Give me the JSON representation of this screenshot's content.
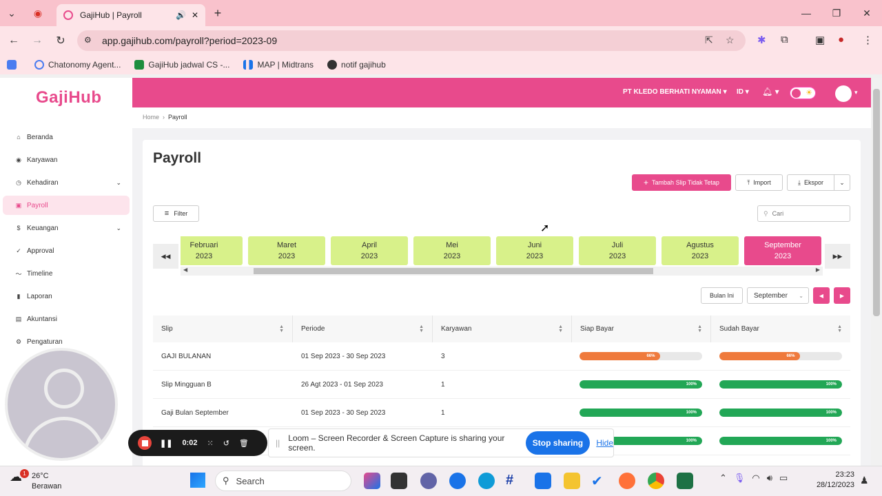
{
  "browser": {
    "tab_title": "GajiHub | Payroll",
    "url": "app.gajihub.com/payroll?period=2023-09",
    "bookmarks": [
      {
        "label": "Chatonomy Agent..."
      },
      {
        "label": "GajiHub jadwal CS -..."
      },
      {
        "label": "MAP | Midtrans"
      },
      {
        "label": "notif gajihub"
      }
    ]
  },
  "app": {
    "logo": "GajiHub",
    "company": "PT KLEDO BERHATI NYAMAN",
    "lang": "ID",
    "sidebar": [
      {
        "label": "Beranda",
        "icon": "home-icon"
      },
      {
        "label": "Karyawan",
        "icon": "users-icon"
      },
      {
        "label": "Kehadiran",
        "icon": "clock-icon"
      },
      {
        "label": "Payroll",
        "icon": "payroll-icon"
      },
      {
        "label": "Keuangan",
        "icon": "money-icon"
      },
      {
        "label": "Approval",
        "icon": "check-icon"
      },
      {
        "label": "Timeline",
        "icon": "timeline-icon"
      },
      {
        "label": "Laporan",
        "icon": "chart-icon"
      },
      {
        "label": "Akuntansi",
        "icon": "book-icon"
      },
      {
        "label": "Pengaturan",
        "icon": "gear-icon"
      }
    ],
    "breadcrumb": {
      "home": "Home",
      "current": "Payroll"
    },
    "page_title": "Payroll",
    "buttons": {
      "add": "Tambah Slip Tidak Tetap",
      "import": "Import",
      "export": "Ekspor",
      "filter": "Filter",
      "this_month": "Bulan Ini"
    },
    "search_placeholder": "Cari",
    "months": [
      {
        "name": "Februari",
        "year": "2023"
      },
      {
        "name": "Maret",
        "year": "2023"
      },
      {
        "name": "April",
        "year": "2023"
      },
      {
        "name": "Mei",
        "year": "2023"
      },
      {
        "name": "Juni",
        "year": "2023"
      },
      {
        "name": "Juli",
        "year": "2023"
      },
      {
        "name": "Agustus",
        "year": "2023"
      },
      {
        "name": "September",
        "year": "2023"
      }
    ],
    "selected_month": "September",
    "table": {
      "headers": [
        "Slip",
        "Periode",
        "Karyawan",
        "Siap Bayar",
        "Sudah Bayar"
      ],
      "rows": [
        {
          "slip": "GAJI BULANAN",
          "period": "01 Sep 2023 - 30 Sep 2023",
          "employees": "3",
          "ready": 66,
          "ready_label": "66%",
          "paid": 66,
          "paid_label": "66%",
          "color": "#ef7a3c"
        },
        {
          "slip": "Slip Mingguan B",
          "period": "26 Agt 2023 - 01 Sep 2023",
          "employees": "1",
          "ready": 100,
          "ready_label": "100%",
          "paid": 100,
          "paid_label": "100%",
          "color": "#22a756"
        },
        {
          "slip": "Gaji Bulan September",
          "period": "01 Sep 2023 - 30 Sep 2023",
          "employees": "1",
          "ready": 100,
          "ready_label": "100%",
          "paid": 100,
          "paid_label": "100%",
          "color": "#22a756"
        },
        {
          "slip": "",
          "period": "",
          "employees": "",
          "ready": 100,
          "ready_label": "100%",
          "paid": 100,
          "paid_label": "100%",
          "color": "#22a756"
        }
      ]
    },
    "colors": {
      "brand": "#e84a8c",
      "month_chip": "#d8f18a"
    }
  },
  "loom": {
    "timer": "0:02",
    "message": "Loom – Screen Recorder & Screen Capture is sharing your screen.",
    "stop_label": "Stop sharing",
    "hide_label": "Hide"
  },
  "taskbar": {
    "weather_temp": "26°C",
    "weather_desc": "Berawan",
    "weather_badge": "1",
    "search_label": "Search",
    "time": "23:23",
    "date": "28/12/2023"
  }
}
